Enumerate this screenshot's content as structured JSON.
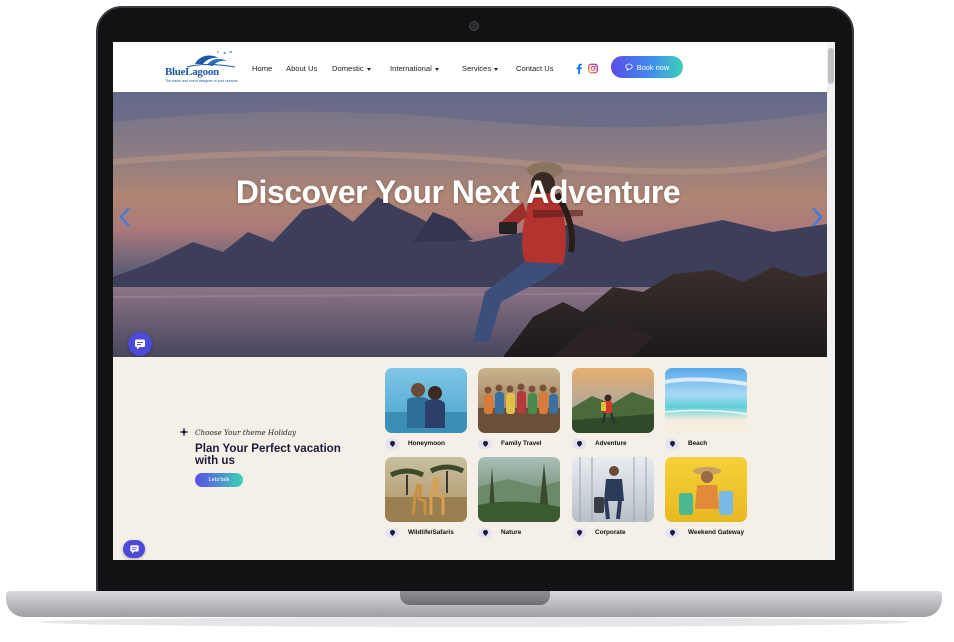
{
  "brand": {
    "name": "BlueLagoon",
    "tagline": "The travel and event designer of your dreams"
  },
  "nav": {
    "home": "Home",
    "about": "About Us",
    "domestic": "Domestic",
    "international": "International",
    "services": "Services",
    "contact": "Contact Us",
    "book_label": "Book now"
  },
  "social": {
    "facebook_icon": "facebook-icon",
    "instagram_icon": "instagram-icon"
  },
  "hero": {
    "title": "Discover Your Next Adventure",
    "prev_icon": "chevron-left-icon",
    "next_icon": "chevron-right-icon"
  },
  "themes": {
    "eyebrow": "Choose Your theme Holiday",
    "heading": "Plan Your Perfect vacation with us",
    "cta": "Lets'talk",
    "cards": [
      {
        "label": "Honeymoon"
      },
      {
        "label": "Family Travel"
      },
      {
        "label": "Adventure"
      },
      {
        "label": "Beach"
      },
      {
        "label": "Wildlife/Safaris"
      },
      {
        "label": "Nature"
      },
      {
        "label": "Corporate"
      },
      {
        "label": "Weekend Gateway"
      }
    ]
  },
  "colors": {
    "accent_start": "#5a4de6",
    "accent_end": "#3fd0b6",
    "brand_blue": "#1e5aa8",
    "chat_purple": "#4d4ad8",
    "section_bg": "#f4f0e8"
  }
}
